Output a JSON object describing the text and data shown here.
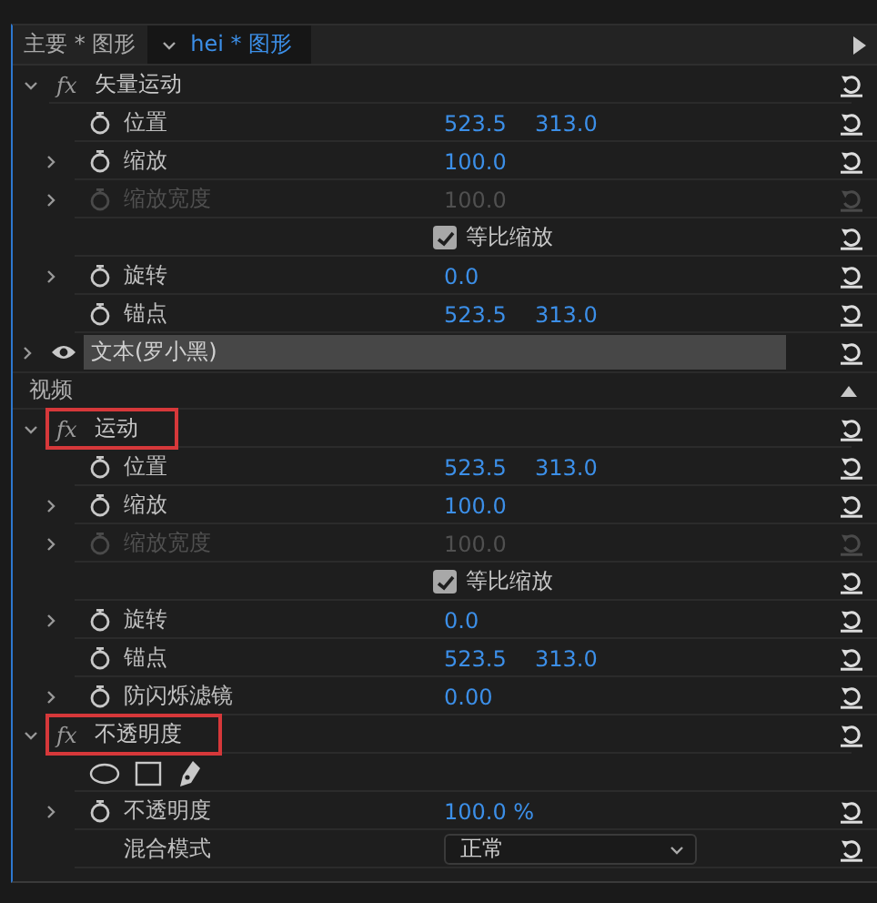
{
  "tabs": [
    {
      "label": "主要 * 图形",
      "selected": false
    },
    {
      "label": "hei * 图形",
      "selected": true
    }
  ],
  "rows": [
    {
      "kind": "effect",
      "badge": "fx",
      "label": "矢量运动",
      "expanded": true,
      "boxed": false
    },
    {
      "kind": "property",
      "label": "位置",
      "values": [
        "523.5",
        "313.0"
      ],
      "disabled": false
    },
    {
      "kind": "property",
      "label": "缩放",
      "values": [
        "100.0"
      ],
      "expanded": false,
      "disabled": false
    },
    {
      "kind": "property",
      "label": "缩放宽度",
      "values": [
        "100.0"
      ],
      "expanded": false,
      "disabled": true
    },
    {
      "kind": "checkbox",
      "label": "等比缩放",
      "checked": true
    },
    {
      "kind": "property",
      "label": "旋转",
      "values": [
        "0.0"
      ],
      "expanded": false,
      "disabled": false
    },
    {
      "kind": "property",
      "label": "锚点",
      "values": [
        "523.5",
        "313.0"
      ],
      "disabled": false
    },
    {
      "kind": "layer",
      "label": "文本(罗小黑)",
      "expanded": false
    },
    {
      "kind": "section",
      "label": "视频"
    },
    {
      "kind": "effect",
      "badge": "fx",
      "label": "运动",
      "expanded": true,
      "boxed": true
    },
    {
      "kind": "property",
      "label": "位置",
      "values": [
        "523.5",
        "313.0"
      ],
      "disabled": false
    },
    {
      "kind": "property",
      "label": "缩放",
      "values": [
        "100.0"
      ],
      "expanded": false,
      "disabled": false
    },
    {
      "kind": "property",
      "label": "缩放宽度",
      "values": [
        "100.0"
      ],
      "expanded": false,
      "disabled": true
    },
    {
      "kind": "checkbox",
      "label": "等比缩放",
      "checked": true
    },
    {
      "kind": "property",
      "label": "旋转",
      "values": [
        "0.0"
      ],
      "expanded": false,
      "disabled": false
    },
    {
      "kind": "property",
      "label": "锚点",
      "values": [
        "523.5",
        "313.0"
      ],
      "disabled": false
    },
    {
      "kind": "property",
      "label": "防闪烁滤镜",
      "values": [
        "0.00"
      ],
      "expanded": false,
      "disabled": false
    },
    {
      "kind": "effect",
      "badge": "fx",
      "label": "不透明度",
      "expanded": true,
      "boxed": true
    },
    {
      "kind": "masks"
    },
    {
      "kind": "property",
      "label": "不透明度",
      "values": [
        "100.0 %"
      ],
      "expanded": false,
      "disabled": false
    },
    {
      "kind": "dropdown",
      "label": "混合模式",
      "value": "正常"
    }
  ]
}
